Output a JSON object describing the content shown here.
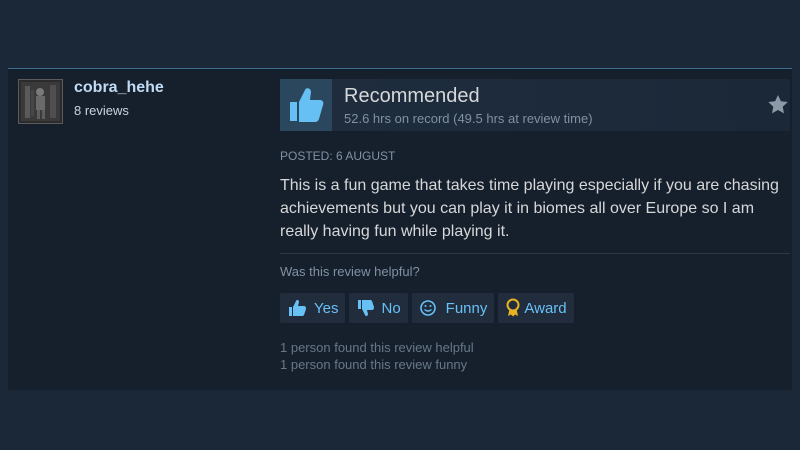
{
  "author": {
    "name": "cobra_hehe",
    "reviews": "8 reviews"
  },
  "review": {
    "verdict": "Recommended",
    "hours": "52.6 hrs on record (49.5 hrs at review time)",
    "posted": "POSTED: 6 AUGUST",
    "text": "This is a fun game that takes time playing especially if you are chasing achievements but you can play it in biomes all over Europe so I am really having fun while playing it.",
    "helpful_question": "Was this review helpful?"
  },
  "controls": {
    "yes": "Yes",
    "no": "No",
    "funny": "Funny",
    "award": "Award"
  },
  "stats": {
    "helpful": "1 person found this review helpful",
    "funny": "1 person found this review funny"
  },
  "icons": {
    "avatar": "avatar-image",
    "verdict": "thumbs-up-icon",
    "star": "star-icon",
    "yes": "thumbs-up-icon",
    "no": "thumbs-down-icon",
    "funny": "smiley-icon",
    "award": "award-ribbon-icon"
  },
  "colors": {
    "background": "#1b2838",
    "card": "#16202d",
    "accent_link": "#67c1f5",
    "thumb_bg": "#2a475e",
    "thumb_icon": "#66c0f4",
    "award_gold": "#e8b323"
  }
}
